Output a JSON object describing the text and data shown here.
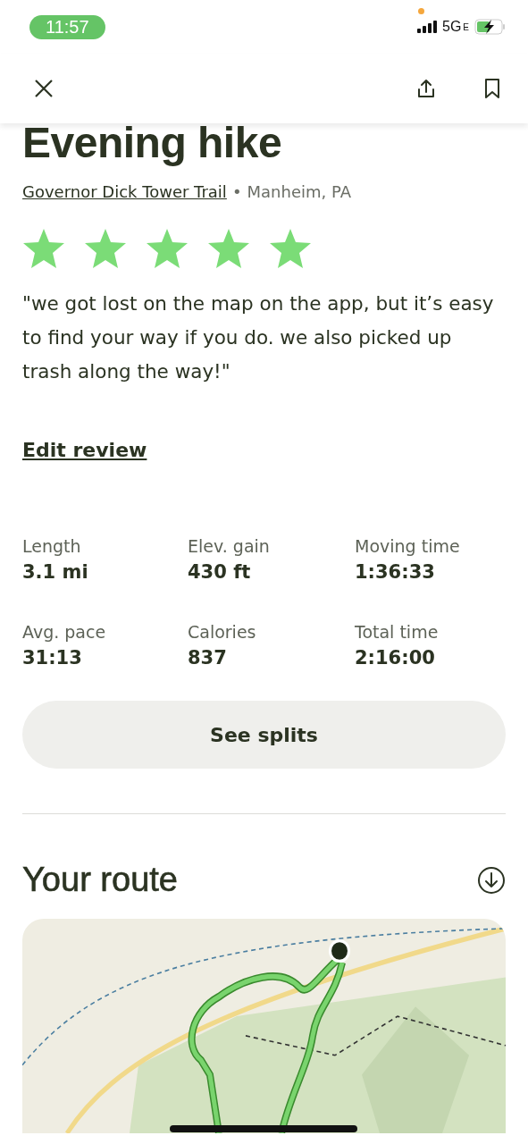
{
  "status_bar": {
    "time": "11:57",
    "network": "5G",
    "network_suffix": "E"
  },
  "header": {
    "buttons": [
      {
        "kind": "close"
      },
      {
        "kind": "share"
      },
      {
        "kind": "bookmark"
      }
    ]
  },
  "activity": {
    "title": "Evening hike",
    "trail": "Governor Dick Tower Trail",
    "separator": "•",
    "location": "Manheim, PA",
    "stars": 5,
    "review": "\"we got lost on the map on the app, but it’s easy to find your way if you do. we also picked up trash along the way!\"",
    "edit_link": "Edit review"
  },
  "stats": [
    {
      "label": "Length",
      "value": "3.1 mi"
    },
    {
      "label": "Elev. gain",
      "value": "430 ft"
    },
    {
      "label": "Moving time",
      "value": "1:36:33"
    },
    {
      "label": "Avg. pace",
      "value": "31:13"
    },
    {
      "label": "Calories",
      "value": "837"
    },
    {
      "label": "Total time",
      "value": "2:16:00"
    }
  ],
  "splits_button": "See splits",
  "route": {
    "title": "Your route"
  }
}
